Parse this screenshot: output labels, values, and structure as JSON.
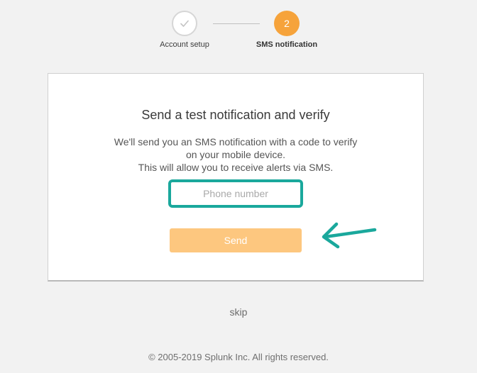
{
  "stepper": {
    "steps": [
      {
        "label": "Account setup",
        "status": "completed",
        "icon": "check-icon"
      },
      {
        "label": "SMS notification",
        "status": "active",
        "number": "2"
      }
    ],
    "active_color": "#f6a33b"
  },
  "card": {
    "title": "Send a test notification and verify",
    "description_lines": [
      "We'll send you an SMS notification with a code to verify",
      "on your mobile device.",
      "This will allow you to receive alerts via SMS."
    ],
    "phone_input": {
      "value": "",
      "placeholder": "Phone number"
    },
    "send_label": "Send"
  },
  "annotations": {
    "highlight_color": "#1aa89c",
    "arrow_icon": "arrow-left-icon"
  },
  "skip_label": "skip",
  "footer": "© 2005-2019 Splunk Inc. All rights reserved.",
  "colors": {
    "send_button": "#fdc77f",
    "background": "#f2f2f2"
  }
}
